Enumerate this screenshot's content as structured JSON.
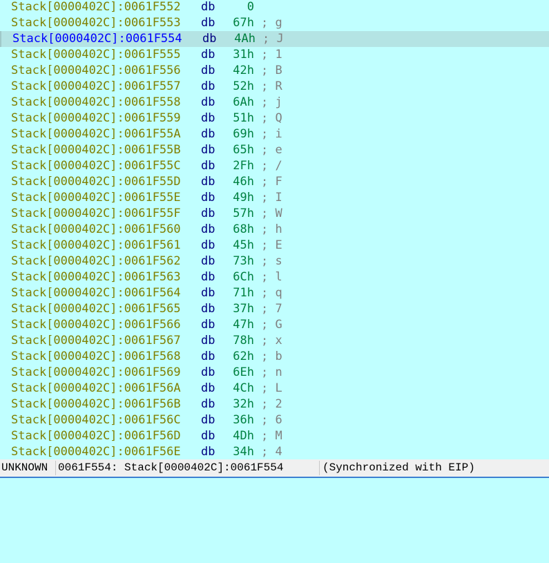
{
  "colors": {
    "background": "#c0ffff",
    "address": "#808000",
    "selected_address": "#0000ff",
    "mnemonic": "#000080",
    "value": "#008040",
    "comment": "#808080",
    "selected_row": "#b4e4e4"
  },
  "selected_index": 2,
  "rows": [
    {
      "addr": "Stack[0000402C]:0061F552",
      "op": "db",
      "val": "0",
      "cmt": ""
    },
    {
      "addr": "Stack[0000402C]:0061F553",
      "op": "db",
      "val": "67h",
      "cmt": "; g"
    },
    {
      "addr": "Stack[0000402C]:0061F554",
      "op": "db",
      "val": "4Ah",
      "cmt": "; J"
    },
    {
      "addr": "Stack[0000402C]:0061F555",
      "op": "db",
      "val": "31h",
      "cmt": "; 1"
    },
    {
      "addr": "Stack[0000402C]:0061F556",
      "op": "db",
      "val": "42h",
      "cmt": "; B"
    },
    {
      "addr": "Stack[0000402C]:0061F557",
      "op": "db",
      "val": "52h",
      "cmt": "; R"
    },
    {
      "addr": "Stack[0000402C]:0061F558",
      "op": "db",
      "val": "6Ah",
      "cmt": "; j"
    },
    {
      "addr": "Stack[0000402C]:0061F559",
      "op": "db",
      "val": "51h",
      "cmt": "; Q"
    },
    {
      "addr": "Stack[0000402C]:0061F55A",
      "op": "db",
      "val": "69h",
      "cmt": "; i"
    },
    {
      "addr": "Stack[0000402C]:0061F55B",
      "op": "db",
      "val": "65h",
      "cmt": "; e"
    },
    {
      "addr": "Stack[0000402C]:0061F55C",
      "op": "db",
      "val": "2Fh",
      "cmt": "; /"
    },
    {
      "addr": "Stack[0000402C]:0061F55D",
      "op": "db",
      "val": "46h",
      "cmt": "; F"
    },
    {
      "addr": "Stack[0000402C]:0061F55E",
      "op": "db",
      "val": "49h",
      "cmt": "; I"
    },
    {
      "addr": "Stack[0000402C]:0061F55F",
      "op": "db",
      "val": "57h",
      "cmt": "; W"
    },
    {
      "addr": "Stack[0000402C]:0061F560",
      "op": "db",
      "val": "68h",
      "cmt": "; h"
    },
    {
      "addr": "Stack[0000402C]:0061F561",
      "op": "db",
      "val": "45h",
      "cmt": "; E"
    },
    {
      "addr": "Stack[0000402C]:0061F562",
      "op": "db",
      "val": "73h",
      "cmt": "; s"
    },
    {
      "addr": "Stack[0000402C]:0061F563",
      "op": "db",
      "val": "6Ch",
      "cmt": "; l"
    },
    {
      "addr": "Stack[0000402C]:0061F564",
      "op": "db",
      "val": "71h",
      "cmt": "; q"
    },
    {
      "addr": "Stack[0000402C]:0061F565",
      "op": "db",
      "val": "37h",
      "cmt": "; 7"
    },
    {
      "addr": "Stack[0000402C]:0061F566",
      "op": "db",
      "val": "47h",
      "cmt": "; G"
    },
    {
      "addr": "Stack[0000402C]:0061F567",
      "op": "db",
      "val": "78h",
      "cmt": "; x"
    },
    {
      "addr": "Stack[0000402C]:0061F568",
      "op": "db",
      "val": "62h",
      "cmt": "; b"
    },
    {
      "addr": "Stack[0000402C]:0061F569",
      "op": "db",
      "val": "6Eh",
      "cmt": "; n"
    },
    {
      "addr": "Stack[0000402C]:0061F56A",
      "op": "db",
      "val": "4Ch",
      "cmt": "; L"
    },
    {
      "addr": "Stack[0000402C]:0061F56B",
      "op": "db",
      "val": "32h",
      "cmt": "; 2"
    },
    {
      "addr": "Stack[0000402C]:0061F56C",
      "op": "db",
      "val": "36h",
      "cmt": "; 6"
    },
    {
      "addr": "Stack[0000402C]:0061F56D",
      "op": "db",
      "val": "4Dh",
      "cmt": "; M"
    },
    {
      "addr": "Stack[0000402C]:0061F56E",
      "op": "db",
      "val": "34h",
      "cmt": "; 4"
    }
  ],
  "status": {
    "mode": "UNKNOWN",
    "location": "0061F554: Stack[0000402C]:0061F554",
    "sync": "(Synchronized with EIP)"
  }
}
